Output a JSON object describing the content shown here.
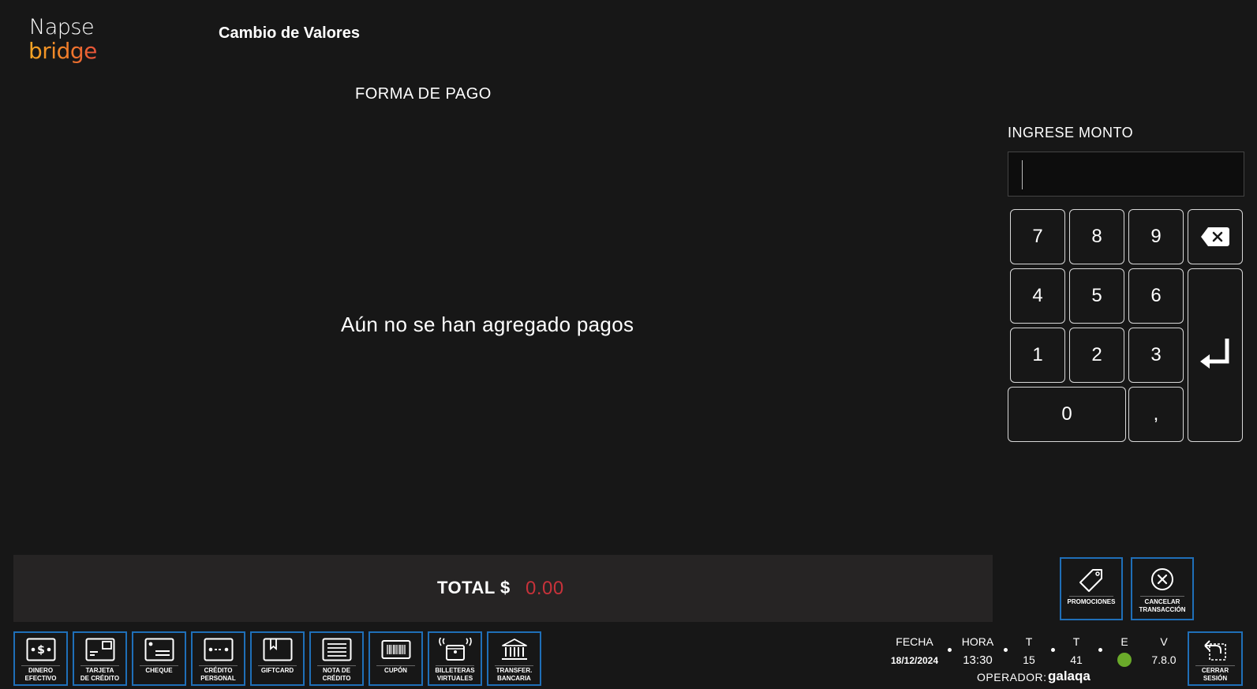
{
  "logo": {
    "line1": "Napse",
    "line2": "bridge"
  },
  "title": "Cambio de Valores",
  "section_title": "FORMA DE PAGO",
  "empty_message": "Aún no se han agregado pagos",
  "amount": {
    "label": "INGRESE MONTO",
    "value": ""
  },
  "keypad": {
    "k7": "7",
    "k8": "8",
    "k9": "9",
    "k4": "4",
    "k5": "5",
    "k6": "6",
    "k1": "1",
    "k2": "2",
    "k3": "3",
    "k0": "0",
    "comma": ","
  },
  "total": {
    "label": "TOTAL $",
    "value": "0.00"
  },
  "payment_methods": [
    {
      "label": "DINERO\nEFECTIVO",
      "icon": "cash-icon"
    },
    {
      "label": "TARJETA\nDE CRÉDITO",
      "icon": "credit-card-icon"
    },
    {
      "label": "CHEQUE",
      "icon": "check-icon"
    },
    {
      "label": "CRÉDITO\nPERSONAL",
      "icon": "personal-credit-icon"
    },
    {
      "label": "GIFTCARD",
      "icon": "giftcard-icon"
    },
    {
      "label": "NOTA DE\nCRÉDITO",
      "icon": "credit-note-icon"
    },
    {
      "label": "CUPÓN",
      "icon": "coupon-barcode-icon"
    },
    {
      "label": "BILLETERAS\nVIRTUALES",
      "icon": "wallet-icon"
    },
    {
      "label": "TRANSFER.\nBANCARIA",
      "icon": "bank-icon"
    }
  ],
  "actions": {
    "promotions": "PROMOCIONES",
    "cancel": "CANCELAR\nTRANSACCIÓN",
    "logout": "CERRAR\nSESIÓN"
  },
  "status": {
    "fecha_label": "FECHA",
    "fecha": "18/12/2024",
    "hora_label": "HORA",
    "hora": "13:30",
    "t1_label": "T",
    "t1": "15",
    "t2_label": "T",
    "t2": "41",
    "e_label": "E",
    "v_label": "V",
    "v": "7.8.0",
    "e_color": "#6aaa2a"
  },
  "operator": {
    "label": "OPERADOR:",
    "value": "galaqa"
  },
  "colors": {
    "accent_border": "#1f6fb8",
    "total_value": "#c8323a",
    "background": "#171717"
  }
}
